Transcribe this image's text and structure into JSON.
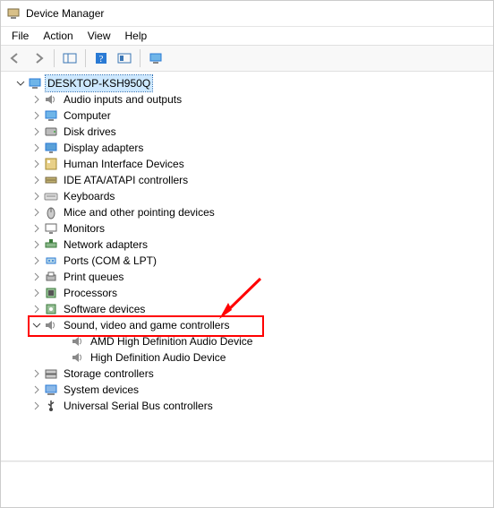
{
  "title": "Device Manager",
  "menu": {
    "file": "File",
    "action": "Action",
    "view": "View",
    "help": "Help"
  },
  "root": {
    "name": "DESKTOP-KSH950Q"
  },
  "categories": [
    {
      "label": "Audio inputs and outputs",
      "icon": "speaker"
    },
    {
      "label": "Computer",
      "icon": "computer"
    },
    {
      "label": "Disk drives",
      "icon": "disk"
    },
    {
      "label": "Display adapters",
      "icon": "display"
    },
    {
      "label": "Human Interface Devices",
      "icon": "hid"
    },
    {
      "label": "IDE ATA/ATAPI controllers",
      "icon": "ide"
    },
    {
      "label": "Keyboards",
      "icon": "keyboard"
    },
    {
      "label": "Mice and other pointing devices",
      "icon": "mouse"
    },
    {
      "label": "Monitors",
      "icon": "monitor"
    },
    {
      "label": "Network adapters",
      "icon": "network"
    },
    {
      "label": "Ports (COM & LPT)",
      "icon": "port"
    },
    {
      "label": "Print queues",
      "icon": "printer"
    },
    {
      "label": "Processors",
      "icon": "cpu"
    },
    {
      "label": "Software devices",
      "icon": "software"
    },
    {
      "label": "Sound, video and game controllers",
      "icon": "speaker",
      "expanded": true,
      "highlighted": true,
      "children": [
        {
          "label": "AMD High Definition Audio Device",
          "icon": "speaker"
        },
        {
          "label": "High Definition Audio Device",
          "icon": "speaker"
        }
      ]
    },
    {
      "label": "Storage controllers",
      "icon": "storage"
    },
    {
      "label": "System devices",
      "icon": "system"
    },
    {
      "label": "Universal Serial Bus controllers",
      "icon": "usb"
    }
  ],
  "annotation": {
    "highlight_index": 14,
    "arrow_color": "#ff0000"
  }
}
